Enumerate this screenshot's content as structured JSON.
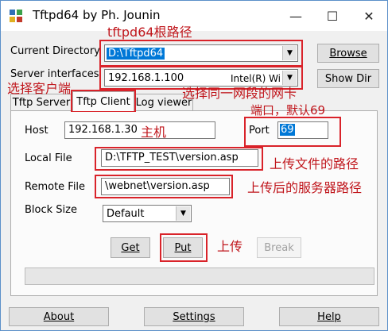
{
  "window": {
    "title": "Tftpd64 by Ph. Jounin",
    "minimize": "—",
    "maximize": "☐",
    "close": "✕"
  },
  "top": {
    "current_directory_label": "Current Directory",
    "current_directory_value": "D:\\Tftpd64",
    "server_interfaces_label": "Server interfaces",
    "server_ip": "192.168.1.100",
    "server_adapter": "Intel(R) Wi",
    "browse_button": "Browse",
    "show_dir_button": "Show Dir"
  },
  "tabs": [
    {
      "label": "Tftp Server",
      "active": false
    },
    {
      "label": "Tftp Client",
      "active": true
    },
    {
      "label": "Log viewer",
      "active": false
    }
  ],
  "client": {
    "host_label": "Host",
    "host_value": "192.168.1.30",
    "port_label": "Port",
    "port_value": "69",
    "local_file_label": "Local File",
    "local_file_value": "D:\\TFTP_TEST\\version.asp",
    "remote_file_label": "Remote File",
    "remote_file_value": "\\webnet\\version.asp",
    "block_size_label": "Block Size",
    "block_size_value": "Default",
    "get_button": "Get",
    "put_button": "Put",
    "break_button": "Break"
  },
  "bottom": {
    "about_button": "About",
    "settings_button": "Settings",
    "help_button": "Help"
  },
  "annotations": {
    "root_path": "tftpd64根路径",
    "select_client": "选择客户端",
    "select_nic": "选择同一网段的网卡",
    "port_default": "端口，默认69",
    "host": "主机",
    "upload_file_path": "上传文件的路径",
    "server_path": "上传后的服务器路径",
    "upload": "上传"
  },
  "colors": {
    "annotation_red": "#d9232a",
    "selection_blue": "#0078d7",
    "window_border": "#5b8fc9"
  }
}
